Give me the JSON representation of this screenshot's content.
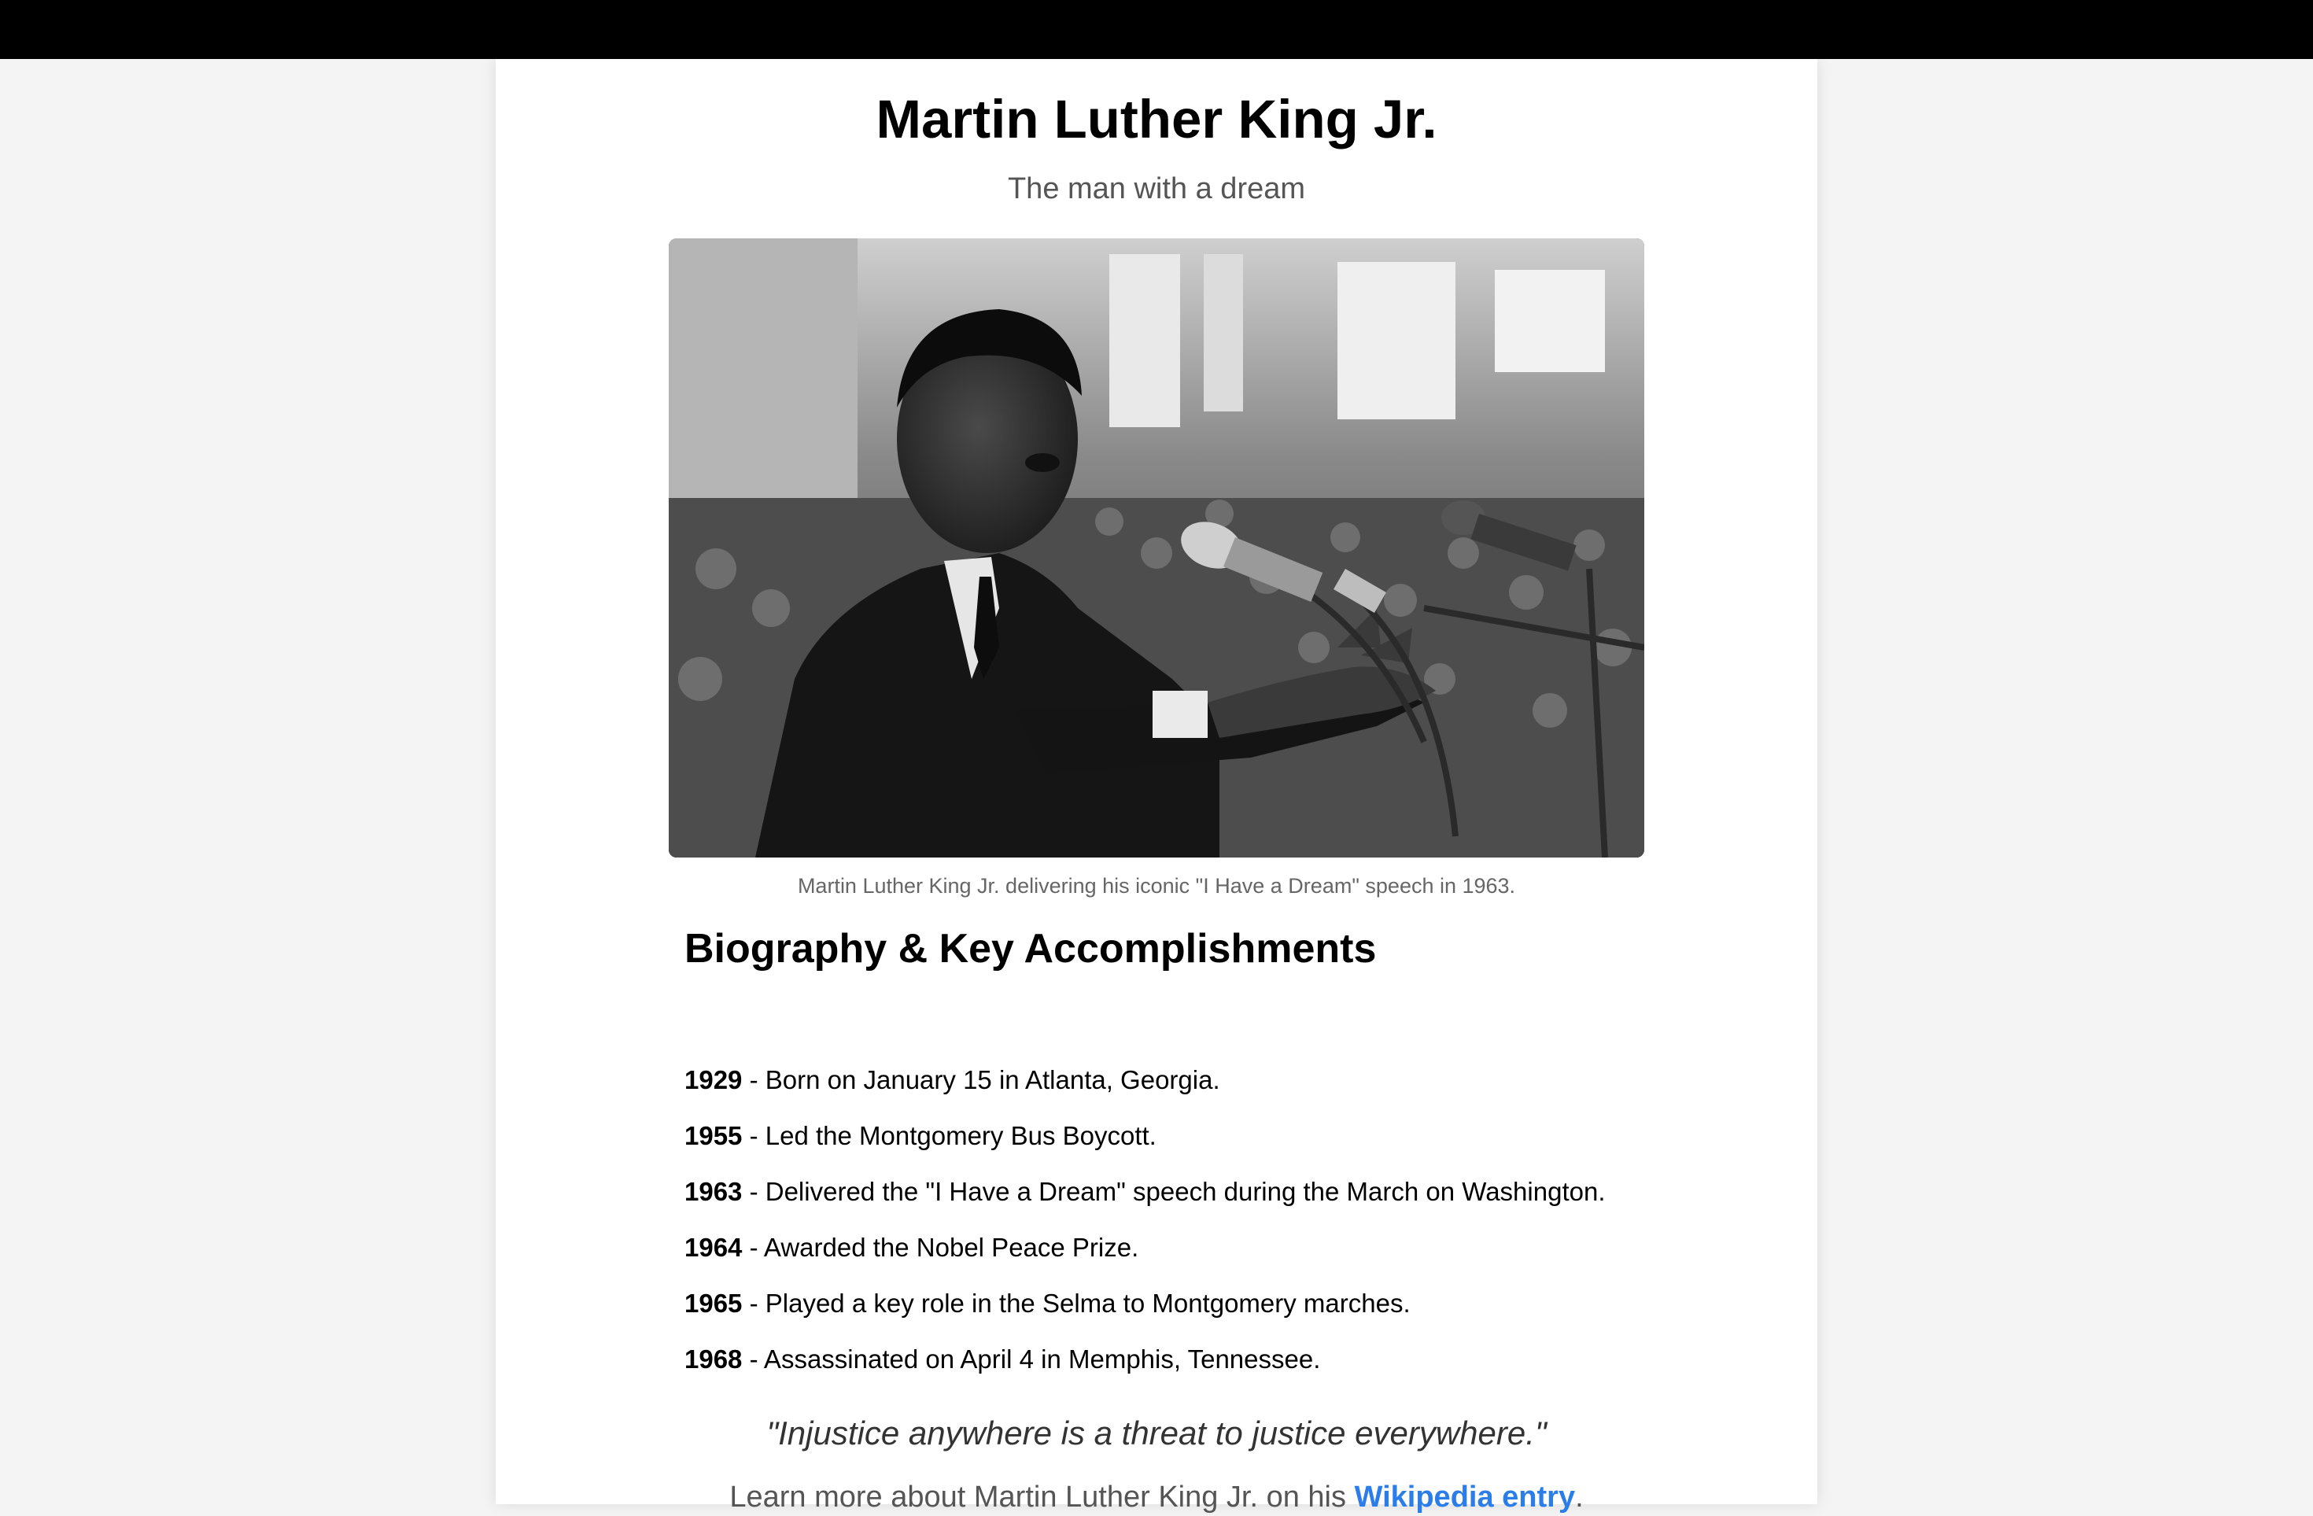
{
  "page": {
    "title": "Martin Luther King Jr.",
    "subtitle": "The man with a dream"
  },
  "photo": {
    "caption": "Martin Luther King Jr. delivering his iconic \"I Have a Dream\" speech in 1963."
  },
  "biography": {
    "heading": "Biography & Key Accomplishments",
    "items": [
      {
        "year": "1929",
        "text": " - Born on January 15 in Atlanta, Georgia."
      },
      {
        "year": "1955",
        "text": " - Led the Montgomery Bus Boycott."
      },
      {
        "year": "1963",
        "text": " - Delivered the \"I Have a Dream\" speech during the March on Washington."
      },
      {
        "year": "1964",
        "text": " - Awarded the Nobel Peace Prize."
      },
      {
        "year": "1965",
        "text": " - Played a key role in the Selma to Montgomery marches."
      },
      {
        "year": "1968",
        "text": " - Assassinated on April 4 in Memphis, Tennessee."
      }
    ]
  },
  "quote": "\"Injustice anywhere is a threat to justice everywhere.\"",
  "footer": {
    "prefix": "Learn more about Martin Luther King Jr. on his ",
    "link_text": "Wikipedia entry",
    "suffix": "."
  },
  "colors": {
    "topbar": "#000000",
    "background": "#f4f4f4",
    "link": "#2b7de9"
  }
}
